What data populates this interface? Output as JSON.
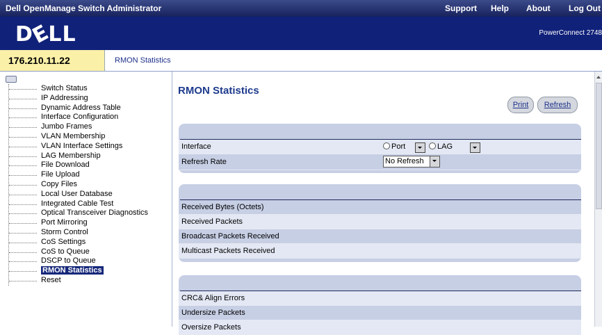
{
  "topbar": {
    "title": "Dell OpenManage Switch Administrator",
    "links": [
      "Support",
      "Help",
      "About",
      "Log Out"
    ]
  },
  "brand": {
    "logo_left": "D",
    "logo_e": "E",
    "logo_right": "LL",
    "product": "PowerConnect 2748"
  },
  "ipbar": {
    "ip": "176.210.11.22",
    "breadcrumb": "RMON Statistics"
  },
  "sidebar": {
    "items": [
      "Switch Status",
      "IP Addressing",
      "Dynamic Address Table",
      "Interface Configuration",
      "Jumbo Frames",
      "VLAN Membership",
      "VLAN Interface Settings",
      "LAG Membership",
      "File Download",
      "File Upload",
      "Copy Files",
      "Local User Database",
      "Integrated Cable Test",
      "Optical Transceiver Diagnostics",
      "Port Mirroring",
      "Storm Control",
      "CoS Settings",
      "CoS to Queue",
      "DSCP to Queue",
      "RMON Statistics",
      "Reset"
    ],
    "selected": "RMON Statistics"
  },
  "main": {
    "title": "RMON Statistics",
    "print_label": "Print",
    "refresh_label": "Refresh",
    "settings": {
      "interface_label": "Interface",
      "port_label": "Port",
      "lag_label": "LAG",
      "refresh_rate_label": "Refresh Rate",
      "refresh_rate_value": "No Refresh"
    },
    "packets_rows": [
      "Received Bytes (Octets)",
      "Received Packets",
      "Broadcast Packets Received",
      "Multicast Packets Received"
    ],
    "errors_rows": [
      "CRC& Align Errors",
      "Undersize Packets",
      "Oversize Packets"
    ]
  },
  "colors": {
    "topbar": "#18235e",
    "brand": "#10217a",
    "ip_highlight": "#fbf0a8",
    "panel": "#c7cfe5",
    "row_alt": "#e3e8f4",
    "title": "#1d3a8c"
  }
}
